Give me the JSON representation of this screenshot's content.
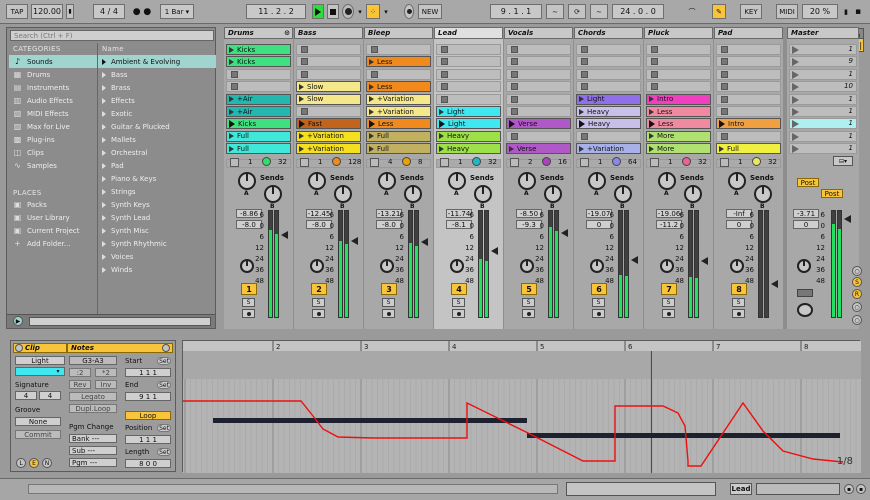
{
  "transport": {
    "tap_label": "TAP",
    "tempo": "120.00",
    "time_sig_num": "4",
    "time_sig_den": "4",
    "quantize": "1 Bar",
    "position": "11 .  2 .  2",
    "new_label": "NEW",
    "loop_start": "9 .  1 .  1",
    "loop_length": "24 .  0 .  0",
    "key_label": "KEY",
    "midi_label": "MIDI",
    "cpu": "20 %",
    "accent_play": "#2adf3c"
  },
  "browser": {
    "search_placeholder": "Search (Ctrl + F)",
    "categories_header": "CATEGORIES",
    "categories": [
      {
        "label": "Sounds",
        "icon": "♪"
      },
      {
        "label": "Drums",
        "icon": "▦"
      },
      {
        "label": "Instruments",
        "icon": "▤"
      },
      {
        "label": "Audio Effects",
        "icon": "▥"
      },
      {
        "label": "MIDI Effects",
        "icon": "▧"
      },
      {
        "label": "Max for Live",
        "icon": "▨"
      },
      {
        "label": "Plug-ins",
        "icon": "▩"
      },
      {
        "label": "Clips",
        "icon": "◫"
      },
      {
        "label": "Samples",
        "icon": "∿"
      }
    ],
    "places_header": "PLACES",
    "places": [
      {
        "label": "Packs",
        "icon": "▣"
      },
      {
        "label": "User Library",
        "icon": "▣"
      },
      {
        "label": "Current Project",
        "icon": "▣"
      },
      {
        "label": "Add Folder...",
        "icon": "+"
      }
    ],
    "name_header": "Name",
    "names": [
      "Ambient & Evolving",
      "Bass",
      "Brass",
      "Effects",
      "Exotic",
      "Guitar & Plucked",
      "Mallets",
      "Orchestral",
      "Pad",
      "Piano & Keys",
      "Strings",
      "Synth Keys",
      "Synth Lead",
      "Synth Misc",
      "Synth Rhythmic",
      "Voices",
      "Winds"
    ]
  },
  "session": {
    "tracks": [
      {
        "name": "Drums",
        "number": "1",
        "s_label": "S",
        "vol": "-8.86",
        "pan": "-8.0",
        "meter": 0.82,
        "io_left": "1",
        "io_right": "32",
        "color": "#2edf6a",
        "clips": [
          {
            "row": 0,
            "label": "Kicks",
            "color": "#3fe080",
            "state": "stop"
          },
          {
            "row": 1,
            "label": "Kicks",
            "color": "#3fe080",
            "state": "stop"
          },
          {
            "row": 4,
            "label": "+Air",
            "color": "#22b8b0",
            "state": "stop"
          },
          {
            "row": 5,
            "label": "+Air",
            "color": "#22b8b0",
            "state": "stop"
          },
          {
            "row": 6,
            "label": "Kicks",
            "color": "#3fe080",
            "state": "play"
          },
          {
            "row": 7,
            "label": "Full",
            "color": "#3fe8d8",
            "state": "stop"
          },
          {
            "row": 8,
            "label": "Full",
            "color": "#3fe8d8",
            "state": "stop"
          }
        ]
      },
      {
        "name": "Bass",
        "number": "2",
        "s_label": "S",
        "vol": "-12.45",
        "pan": "-8.0",
        "meter": 0.72,
        "io_left": "1",
        "io_right": "128",
        "color": "#f08a1c",
        "clips": [
          {
            "row": 3,
            "label": "Slow",
            "color": "#f5e88a",
            "state": "stop"
          },
          {
            "row": 4,
            "label": "Slow",
            "color": "#f5e88a",
            "state": "stop"
          },
          {
            "row": 6,
            "label": "Fast",
            "color": "#c2641c",
            "state": "play"
          },
          {
            "row": 7,
            "label": "+Variation",
            "color": "#f5e020",
            "state": "stop"
          },
          {
            "row": 8,
            "label": "+Variation",
            "color": "#f5e020",
            "state": "stop"
          }
        ]
      },
      {
        "name": "Bleep",
        "number": "3",
        "s_label": "S",
        "vol": "-13.21",
        "pan": "-8.0",
        "meter": 0.7,
        "io_left": "4",
        "io_right": "8",
        "color": "#f0a000",
        "clips": [
          {
            "row": 1,
            "label": "Less",
            "color": "#f08a1c",
            "state": "stop"
          },
          {
            "row": 3,
            "label": "Less",
            "color": "#f08a1c",
            "state": "stop"
          },
          {
            "row": 4,
            "label": "+Variation",
            "color": "#f5e88a",
            "state": "stop"
          },
          {
            "row": 5,
            "label": "+Variation",
            "color": "#f5e88a",
            "state": "stop"
          },
          {
            "row": 6,
            "label": "Less",
            "color": "#f08a1c",
            "state": "play"
          },
          {
            "row": 7,
            "label": "Full",
            "color": "#c0b060",
            "state": "stop"
          },
          {
            "row": 8,
            "label": "Full",
            "color": "#c0b060",
            "state": "stop"
          }
        ]
      },
      {
        "name": "Lead",
        "number": "4",
        "s_label": "S",
        "vol": "-11.74",
        "pan": "-8.1",
        "meter": 0.55,
        "io_left": "1",
        "io_right": "32",
        "color": "#1fb8c8",
        "clips": [
          {
            "row": 5,
            "label": "Light",
            "color": "#3fe8f0",
            "state": "stop"
          },
          {
            "row": 6,
            "label": "Light",
            "color": "#3fe8f0",
            "state": "play"
          },
          {
            "row": 7,
            "label": "Heavy",
            "color": "#9de048",
            "state": "stop"
          },
          {
            "row": 8,
            "label": "Heavy",
            "color": "#9de048",
            "state": "stop"
          }
        ]
      },
      {
        "name": "Vocals",
        "number": "5",
        "s_label": "S",
        "vol": "-8.50",
        "pan": "-9.3",
        "meter": 0.85,
        "io_left": "2",
        "io_right": "16",
        "color": "#b040c0",
        "clips": [
          {
            "row": 6,
            "label": "Verse",
            "color": "#b058c8",
            "state": "play"
          },
          {
            "row": 8,
            "label": "Verse",
            "color": "#b058c8",
            "state": "stop"
          }
        ]
      },
      {
        "name": "Chords",
        "number": "6",
        "s_label": "S",
        "vol": "-19.07",
        "pan": "0",
        "meter": 0.4,
        "io_left": "1",
        "io_right": "64",
        "color": "#8888ee",
        "clips": [
          {
            "row": 4,
            "label": "Light",
            "color": "#9070e8",
            "state": "stop"
          },
          {
            "row": 5,
            "label": "Heavy",
            "color": "#c8c0e8",
            "state": "stop"
          },
          {
            "row": 6,
            "label": "Heavy",
            "color": "#c8c0e8",
            "state": "play"
          },
          {
            "row": 8,
            "label": "+Variation",
            "color": "#a8b0e8",
            "state": "stop"
          }
        ]
      },
      {
        "name": "Pluck",
        "number": "7",
        "s_label": "S",
        "vol": "-19.06",
        "pan": "-11.2",
        "meter": 0.38,
        "io_left": "1",
        "io_right": "32",
        "color": "#f06090",
        "clips": [
          {
            "row": 4,
            "label": "Intro",
            "color": "#f040c0",
            "state": "stop"
          },
          {
            "row": 5,
            "label": "Less",
            "color": "#f08aa0",
            "state": "stop"
          },
          {
            "row": 6,
            "label": "Less",
            "color": "#f08aa0",
            "state": "play"
          },
          {
            "row": 7,
            "label": "More",
            "color": "#b0e070",
            "state": "stop"
          },
          {
            "row": 8,
            "label": "More",
            "color": "#b0e070",
            "state": "stop"
          }
        ]
      },
      {
        "name": "Pad",
        "number": "8",
        "s_label": "S",
        "vol": "-Inf",
        "pan": "0",
        "meter": 0.0,
        "io_left": "1",
        "io_right": "32",
        "color": "#e8e860",
        "clips": [
          {
            "row": 6,
            "label": "Intro",
            "color": "#f0a040",
            "state": "play"
          },
          {
            "row": 8,
            "label": "Full",
            "color": "#f0f040",
            "state": "stop"
          }
        ]
      }
    ],
    "master": {
      "name": "Master",
      "scenes": [
        "1",
        "9",
        "1",
        "10",
        "1",
        "1",
        "1",
        "1",
        "1"
      ],
      "vol": "-3.71",
      "pan": "0",
      "post_label": "Post",
      "meter": 0.88
    },
    "sends_label": "Sends",
    "scale": [
      "6",
      "0",
      "6",
      "12",
      "24",
      "36",
      "48"
    ]
  },
  "clip_view": {
    "clip_header": "Clip",
    "clip_name": "Light",
    "signature_label": "Signature",
    "sig_num": "4",
    "sig_den": "4",
    "groove_label": "Groove",
    "groove_value": "None",
    "commit_label": "Commit",
    "notes_header": "Notes",
    "note_range": "G3-A3",
    "btn_2": ":2",
    "btn_x2": "*2",
    "btn_rev": "Rev",
    "btn_inv": "Inv",
    "btn_legato": "Legato",
    "btn_dupl": "Dupl.Loop",
    "pgm_change": "Pgm Change",
    "bank": "Bank ---",
    "sub": "Sub ---",
    "pgm": "Pgm ---",
    "start_label": "Start",
    "start_val": "1   1   1",
    "end_label": "End",
    "end_val": "9   1   1",
    "loop_label": "Loop",
    "position_label": "Position",
    "pos_val": "1   1   1",
    "length_label": "Length",
    "len_val": "8   0   0",
    "set_label": "Set"
  },
  "editor": {
    "bars": [
      "2",
      "3",
      "4",
      "5",
      "6",
      "7",
      "8"
    ],
    "page": "1/8",
    "envelope_color": "#ee1010",
    "notes_color": "#1e2230"
  },
  "bottom": {
    "track_label": "Lead"
  }
}
